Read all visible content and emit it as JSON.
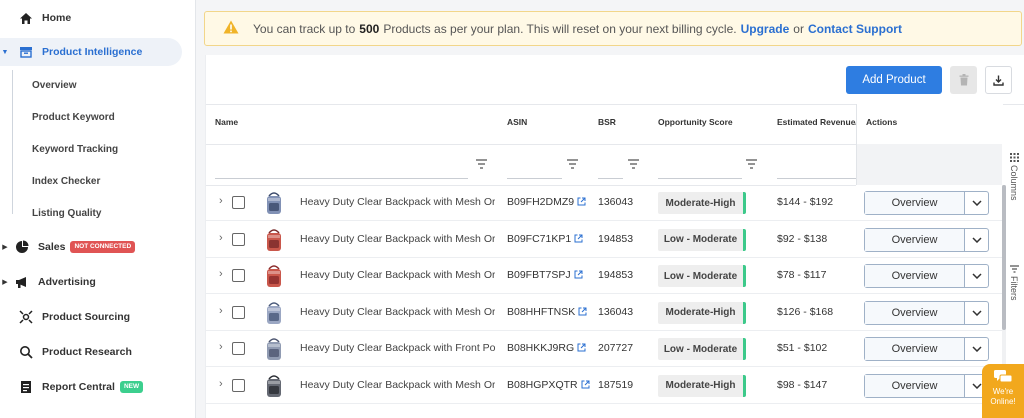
{
  "sidebar": {
    "home": "Home",
    "product_intelligence": "Product Intelligence",
    "sub_items": [
      "Overview",
      "Product Keyword",
      "Keyword Tracking",
      "Index Checker",
      "Listing Quality"
    ],
    "sales": "Sales",
    "sales_badge": "NOT CONNECTED",
    "advertising": "Advertising",
    "product_sourcing": "Product Sourcing",
    "product_research": "Product Research",
    "report_central": "Report Central",
    "report_badge": "NEW"
  },
  "alert": {
    "prefix": "You can track up to",
    "count": "500",
    "message": "Products as per your plan. This will reset on your next billing cycle.",
    "upgrade": "Upgrade",
    "or": "or",
    "contact": "Contact Support"
  },
  "toolbar": {
    "add_product": "Add Product"
  },
  "table": {
    "columns": {
      "name": "Name",
      "asin": "ASIN",
      "bsr": "BSR",
      "opportunity": "Opportunity Score",
      "revenue": "Estimated Revenue/",
      "actions": "Actions"
    },
    "side_tabs": {
      "columns": "Columns",
      "filters": "Filters"
    },
    "rows": [
      {
        "name": "Heavy Duty Clear Backpack with Mesh Or...",
        "asin": "B09FH2DMZ9",
        "bsr": "136043",
        "opportunity": "Moderate-High",
        "revenue": "$144 - $192",
        "action": "Overview"
      },
      {
        "name": "Heavy Duty Clear Backpack with Mesh Or...",
        "asin": "B09FC71KP1",
        "bsr": "194853",
        "opportunity": "Low - Moderate",
        "revenue": "$92 - $138",
        "action": "Overview"
      },
      {
        "name": "Heavy Duty Clear Backpack with Mesh Or...",
        "asin": "B09FBT7SPJ",
        "bsr": "194853",
        "opportunity": "Low - Moderate",
        "revenue": "$78 - $117",
        "action": "Overview"
      },
      {
        "name": "Heavy Duty Clear Backpack with Mesh Or...",
        "asin": "B08HHFTNSK",
        "bsr": "136043",
        "opportunity": "Moderate-High",
        "revenue": "$126 - $168",
        "action": "Overview"
      },
      {
        "name": "Heavy Duty Clear Backpack with Front Po...",
        "asin": "B08HKKJ9RG",
        "bsr": "207727",
        "opportunity": "Low - Moderate",
        "revenue": "$51 - $102",
        "action": "Overview"
      },
      {
        "name": "Heavy Duty Clear Backpack with Mesh Or...",
        "asin": "B08HGPXQTR",
        "bsr": "187519",
        "opportunity": "Moderate-High",
        "revenue": "$98 - $147",
        "action": "Overview"
      }
    ]
  },
  "chat": {
    "line1": "We're",
    "line2": "Online!"
  }
}
